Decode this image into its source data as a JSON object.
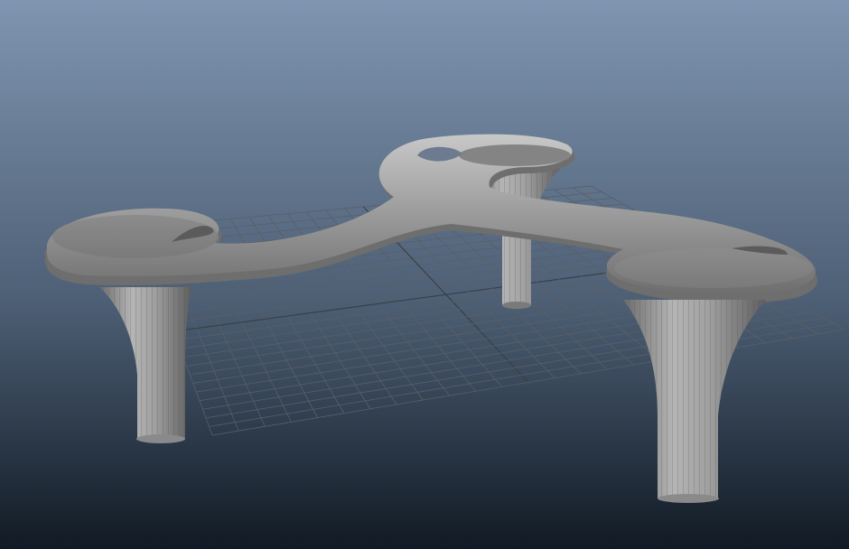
{
  "viewport": {
    "background_top": "#7f95b0",
    "background_mid": "#4d5f75",
    "background_bottom": "#111a24",
    "grid_color": "#5a5f66",
    "grid_axis_color": "#3b3f44",
    "model_color": "#9a9a9a",
    "model_shadow": "#5a5a5a",
    "model_highlight": "#c4c4c4"
  },
  "objects": [
    {
      "name": "ground-grid-icon"
    },
    {
      "name": "table-top-icon"
    },
    {
      "name": "table-leg-left-icon"
    },
    {
      "name": "table-leg-back-icon"
    },
    {
      "name": "table-leg-right-icon"
    }
  ]
}
